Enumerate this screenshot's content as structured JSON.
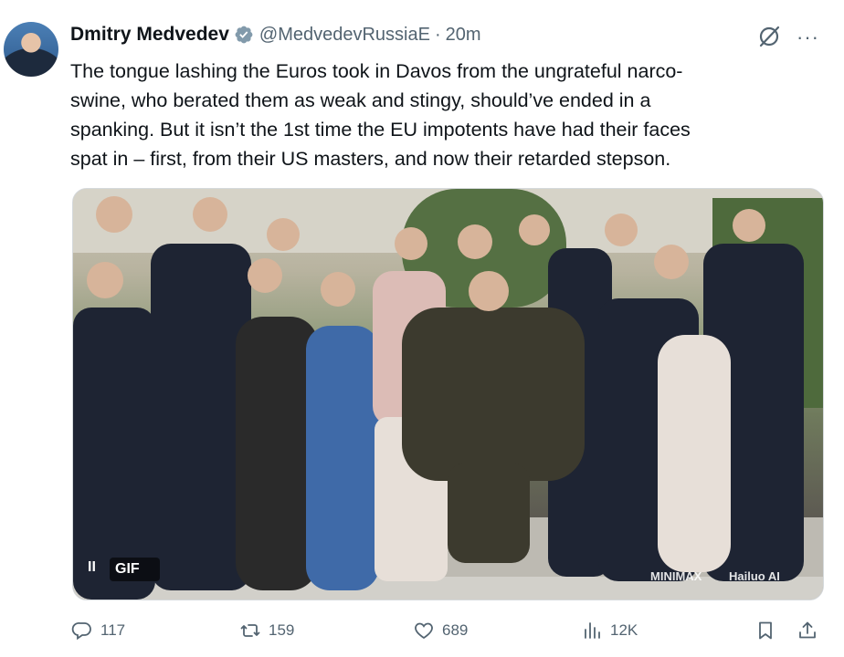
{
  "tweet": {
    "author_name": "Dmitry Medvedev",
    "handle": "@MedvedevRussiaE",
    "separator": "·",
    "time": "20m",
    "text": "The tongue lashing the Euros took in Davos from the ungrateful narco-\nswine, who berated them as weak and stingy, should’ve ended in a\nspanking. But it isn’t the 1st time the EU impotents have had their faces\nspat in – first, from their US masters, and now their retarded stepson.",
    "more_label": "···"
  },
  "media": {
    "badge": "GIF",
    "pause_glyph": "II",
    "watermark_left": "MINIMAX",
    "watermark_right": "Hailuo AI"
  },
  "actions": {
    "replies": "117",
    "reposts": "159",
    "likes": "689",
    "views": "12K"
  },
  "colors": {
    "text": "#0f1419",
    "secondary": "#536471",
    "verified_badge": "#829aab"
  }
}
